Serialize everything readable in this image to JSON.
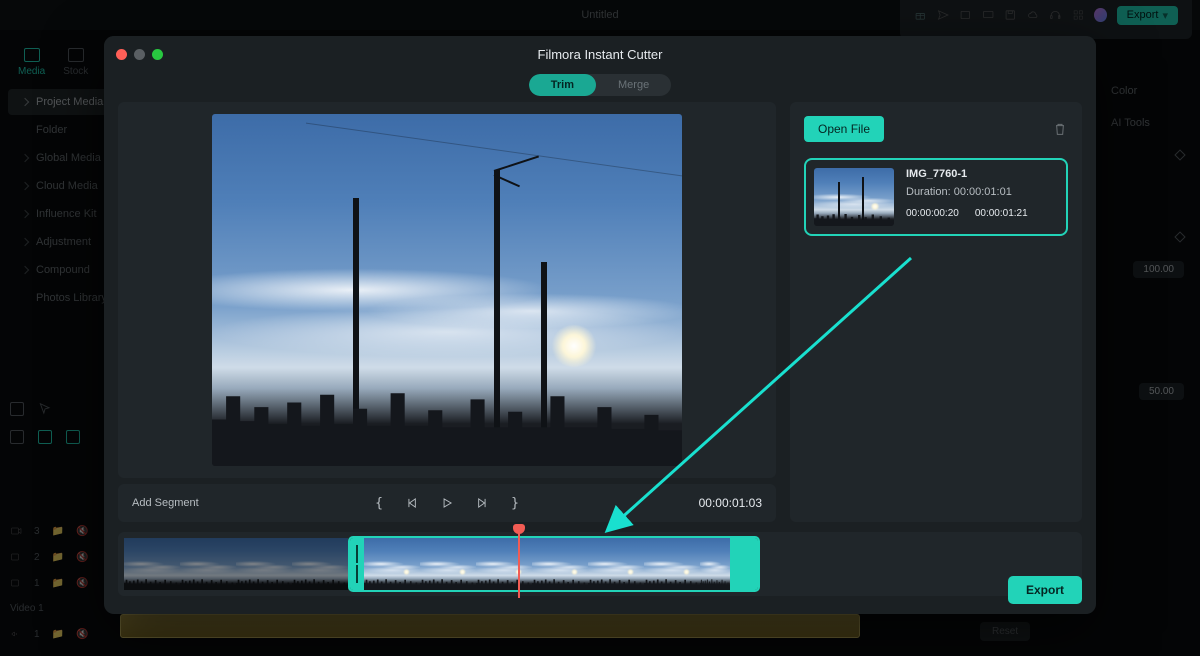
{
  "app": {
    "title": "Untitled",
    "export_label": "Export"
  },
  "right_props": {
    "header": "Color",
    "tools": "AI Tools",
    "val1": "100.00",
    "val2": "50.00",
    "reset": "Reset"
  },
  "sidebar": {
    "tabs": {
      "media": "Media",
      "stock": "Stock"
    },
    "rows": [
      "Project Media",
      "Folder",
      "Global Media",
      "Cloud Media",
      "Influence Kit",
      "Adjustment",
      "Compound",
      "Photos Library"
    ]
  },
  "timeline_left": {
    "video": "Video 1"
  },
  "modal": {
    "title": "Filmora Instant Cutter",
    "tabs": {
      "trim": "Trim",
      "merge": "Merge"
    },
    "open_file": "Open File",
    "add_segment": "Add Segment",
    "timecode": "00:00:01:03",
    "export": "Export",
    "clip": {
      "name": "IMG_7760-1",
      "duration_label": "Duration:",
      "duration": "00:00:01:01",
      "in": "00:00:00:20",
      "out": "00:00:01:21"
    }
  }
}
